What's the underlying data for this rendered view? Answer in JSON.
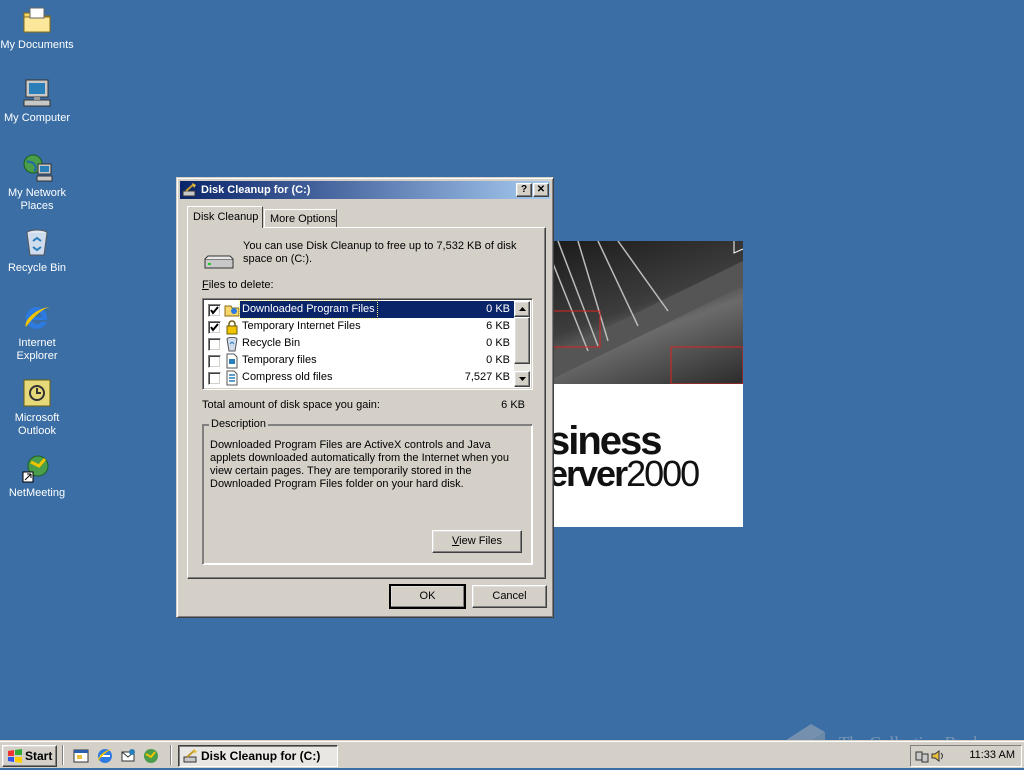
{
  "desktop": {
    "icons": [
      {
        "label": "My Documents"
      },
      {
        "label": "My Computer"
      },
      {
        "label": "My Network Places"
      },
      {
        "label": "Recycle Bin"
      },
      {
        "label": "Internet Explorer"
      },
      {
        "label": "Microsoft Outlook"
      },
      {
        "label": "NetMeeting"
      }
    ]
  },
  "splash": {
    "line1": "siness",
    "line2_word": "erver",
    "line2_num": "2000"
  },
  "dialog": {
    "title": "Disk Cleanup for  (C:)",
    "help_button": "?",
    "close_button": "✕",
    "tabs": [
      {
        "label": "Disk Cleanup",
        "active": true
      },
      {
        "label": "More Options",
        "active": false
      }
    ],
    "intro": "You can use Disk Cleanup to free up to 7,532 KB of disk space on  (C:).",
    "files_label_u": "F",
    "files_label_rest": "iles to delete:",
    "files": [
      {
        "name": "Downloaded Program Files",
        "size": "0 KB",
        "checked": true,
        "selected": true,
        "icon": "downloaded-files-icon"
      },
      {
        "name": "Temporary Internet Files",
        "size": "6 KB",
        "checked": true,
        "selected": false,
        "icon": "lock-icon"
      },
      {
        "name": "Recycle Bin",
        "size": "0 KB",
        "checked": false,
        "selected": false,
        "icon": "recycle-bin-icon"
      },
      {
        "name": "Temporary files",
        "size": "0 KB",
        "checked": false,
        "selected": false,
        "icon": "file-icon"
      },
      {
        "name": "Compress old files",
        "size": "7,527 KB",
        "checked": false,
        "selected": false,
        "icon": "compress-icon"
      }
    ],
    "total_label": "Total amount of disk space you gain:",
    "total_value": "6 KB",
    "description_legend": "Description",
    "description": "Downloaded Program Files are ActiveX controls and Java applets downloaded automatically from the Internet when you view certain pages. They are temporarily stored in the Downloaded Program Files folder on your hard disk.",
    "view_files_u": "V",
    "view_files_rest": "iew Files",
    "ok_label": "OK",
    "cancel_label": "Cancel"
  },
  "taskbar": {
    "start_label": "Start",
    "task_label": "Disk Cleanup for  (C:)",
    "clock": "11:33 AM"
  },
  "watermark": {
    "text": "The Collection Book"
  },
  "colors": {
    "desktop": "#3a6ea5",
    "title_active_start": "#0a246a",
    "title_active_end": "#a6caf0",
    "face": "#d4d0c8",
    "selection": "#0a246a"
  }
}
